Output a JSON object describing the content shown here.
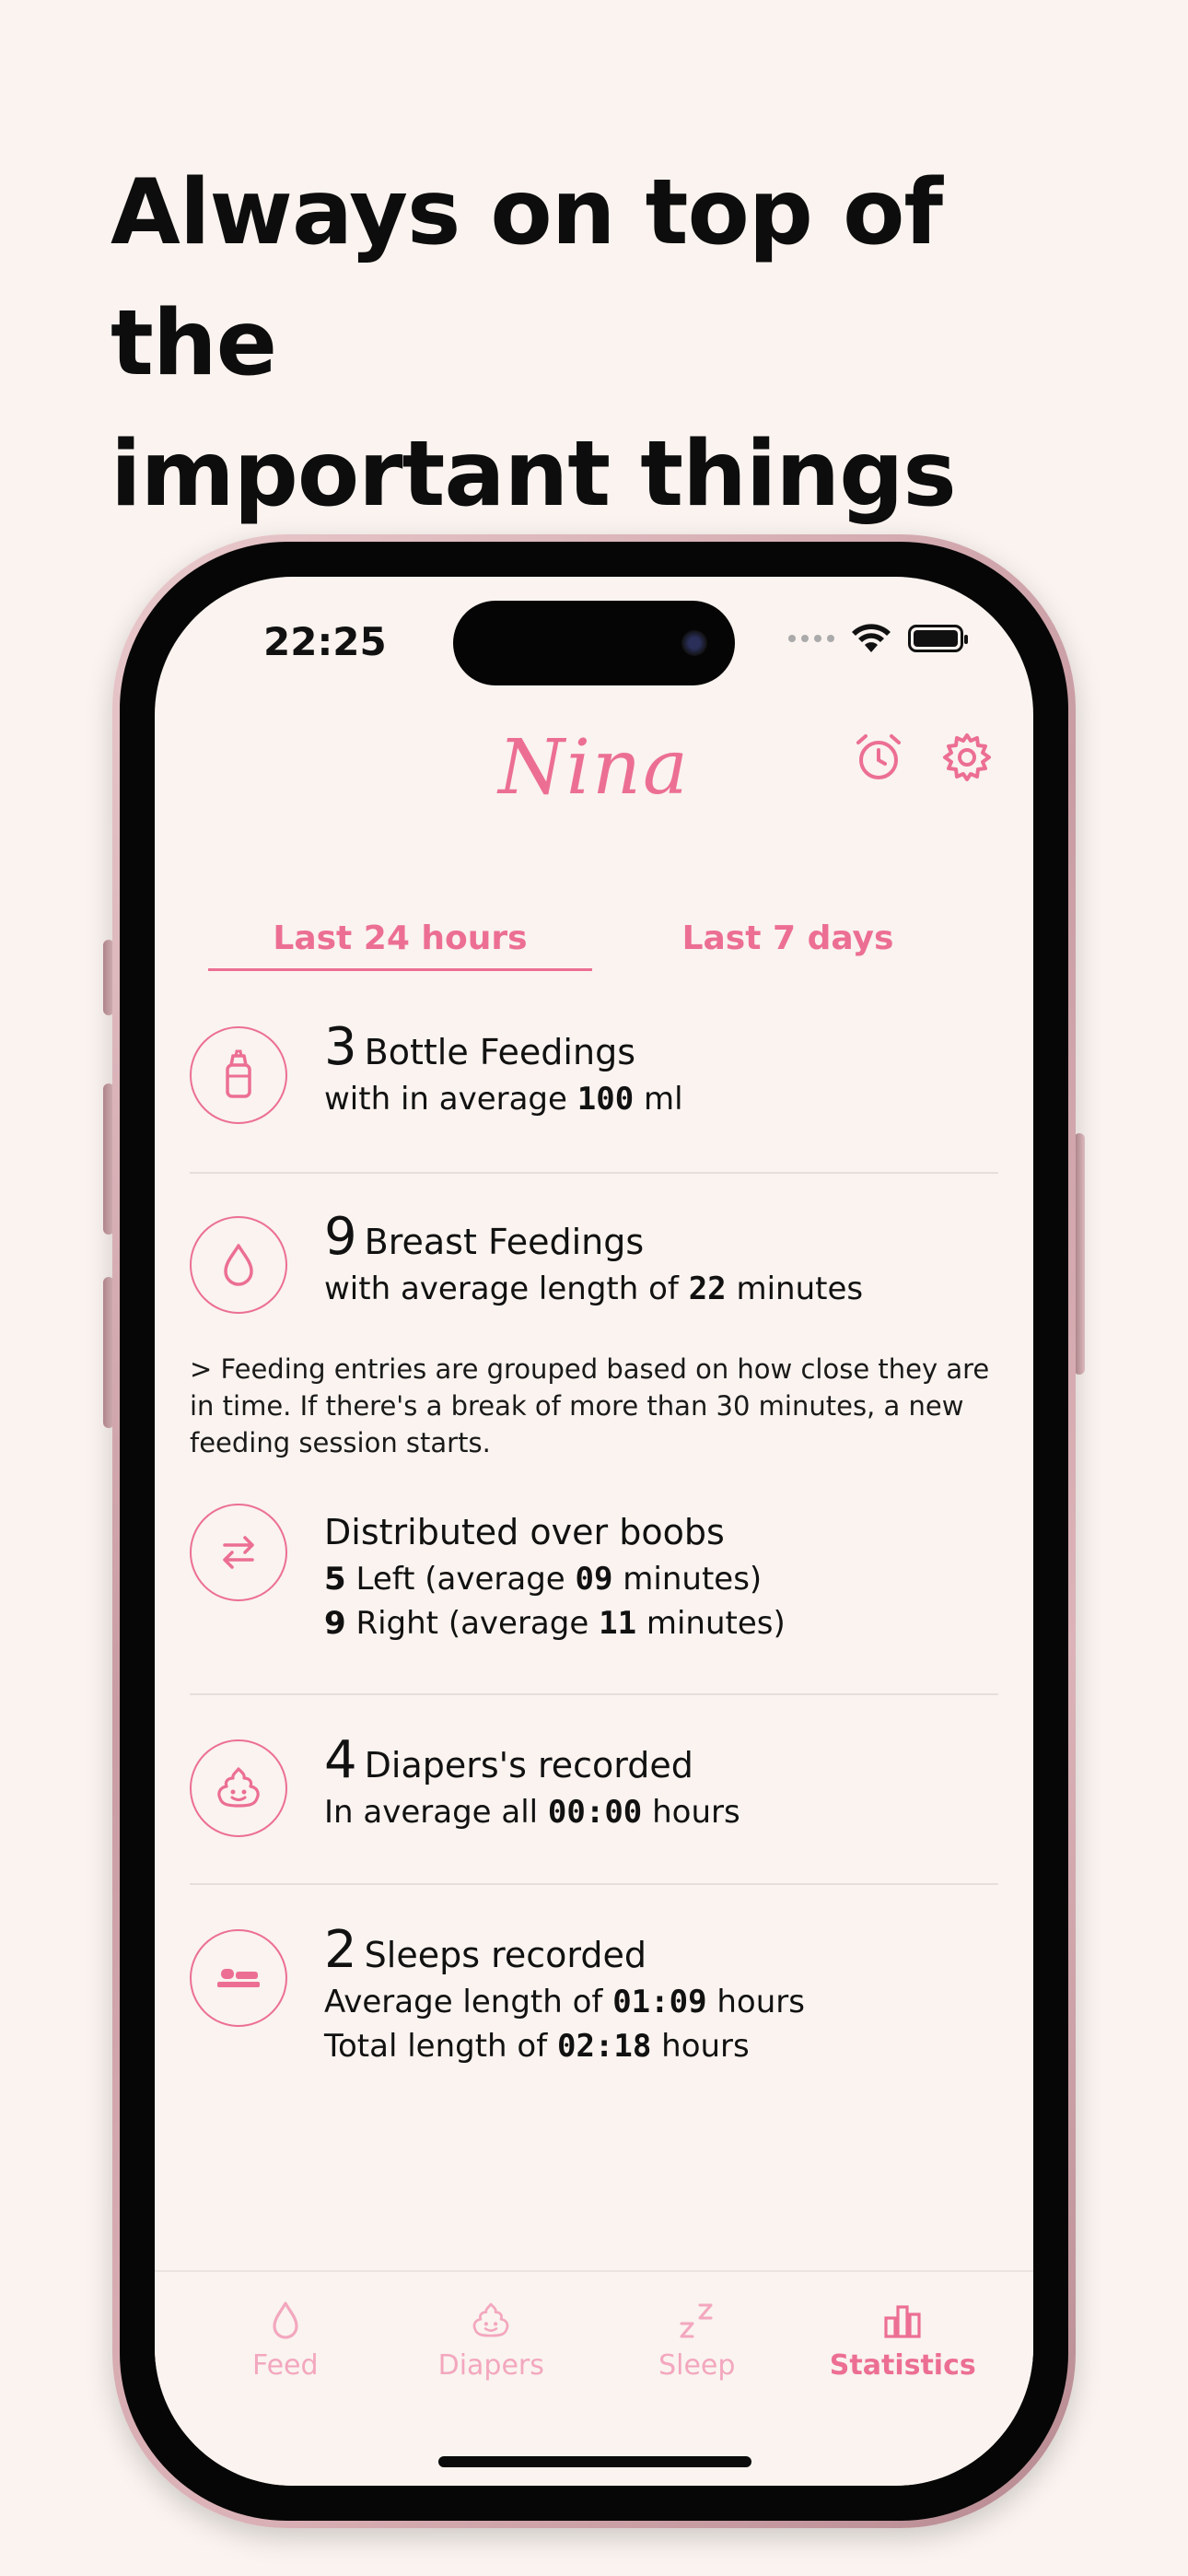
{
  "headline": {
    "line1": "Always on top of the",
    "line2": "important things"
  },
  "status_bar": {
    "time": "22:25",
    "icons": [
      "signal-dots-icon",
      "wifi-icon",
      "battery-icon"
    ]
  },
  "app": {
    "title": "Nina",
    "header_icons": [
      "alarm-clock-icon",
      "gear-icon"
    ],
    "accent_color": "#ec6f93"
  },
  "period_tabs": [
    {
      "label": "Last 24 hours",
      "active": true
    },
    {
      "label": "Last 7 days",
      "active": false
    }
  ],
  "stats": {
    "bottle": {
      "icon": "baby-bottle-icon",
      "count": "3",
      "title": "Bottle Feedings",
      "line_prefix": "with in average ",
      "line_value": "100",
      "line_suffix": " ml"
    },
    "breast": {
      "icon": "drop-icon",
      "count": "9",
      "title": "Breast Feedings",
      "line_prefix": "with average length of ",
      "line_value": "22",
      "line_suffix": " minutes"
    },
    "note": "> Feeding entries are grouped based on how close they are in time. If there's a break of more than 30 minutes, a new feeding session starts.",
    "boobs": {
      "icon": "swap-arrows-icon",
      "title": "Distributed over boobs",
      "left_count": "5",
      "left_label": " Left (average ",
      "left_value": "09",
      "left_suffix": " minutes)",
      "right_count": "9",
      "right_label": " Right (average ",
      "right_value": "11",
      "right_suffix": " minutes)"
    },
    "diapers": {
      "icon": "poop-icon",
      "count": "4",
      "title": "Diapers's recorded",
      "line_prefix": "In average all ",
      "line_value": "00:00",
      "line_suffix": " hours"
    },
    "sleeps": {
      "icon": "bed-icon",
      "count": "2",
      "title": "Sleeps recorded",
      "avg_prefix": "Average length of ",
      "avg_value": "01:09",
      "avg_suffix": " hours",
      "total_prefix": "Total length of ",
      "total_value": "02:18",
      "total_suffix": " hours"
    }
  },
  "tabbar": [
    {
      "label": "Feed",
      "icon": "drop-icon",
      "active": false
    },
    {
      "label": "Diapers",
      "icon": "poop-icon",
      "active": false
    },
    {
      "label": "Sleep",
      "icon": "zzz-icon",
      "active": false
    },
    {
      "label": "Statistics",
      "icon": "bar-chart-icon",
      "active": true
    }
  ]
}
